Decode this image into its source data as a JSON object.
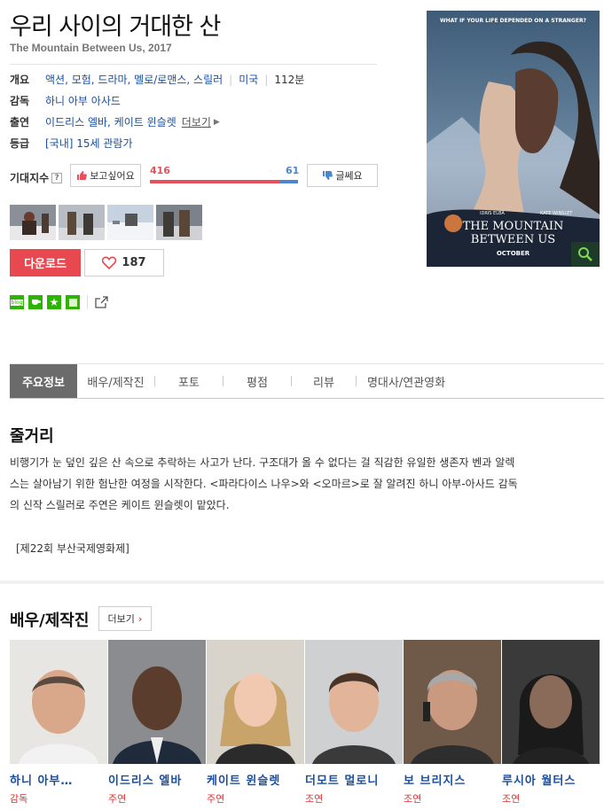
{
  "movie": {
    "title": "우리 사이의 거대한 산",
    "subtitle": "The Mountain Between Us, 2017"
  },
  "info": {
    "overview_label": "개요",
    "genres": "액션, 모험, 드라마, 멜로/로맨스, 스릴러",
    "country": "미국",
    "runtime": "112분",
    "director_label": "감독",
    "director": "하니 아부 아사드",
    "cast_label": "출연",
    "cast": "이드리스 엘바, 케이트 윈슬렛",
    "more_label": "더보기",
    "rating_label": "등급",
    "rating": "[국내] 15세 관람가"
  },
  "expect": {
    "label": "기대지수",
    "help": "?",
    "want_label": "보고싶어요",
    "want_count": "416",
    "meh_label": "글쎄요",
    "meh_count": "61",
    "colors": {
      "want": "#e8505b",
      "meh": "#4a86d4"
    }
  },
  "actions": {
    "download_label": "다운로드",
    "like_count": "187",
    "accent": "#e8484f"
  },
  "share": {
    "icons": [
      "blog-icon",
      "cafe-icon",
      "star-icon",
      "square-icon",
      "share-icon"
    ],
    "blog_text": "blog"
  },
  "poster": {
    "tagline": "WHAT IF YOUR LIFE DEPENDED ON A STRANGER?",
    "actor1": "IDRIS ELBA",
    "actor2": "KATE WINSLET",
    "title_line1": "THE MOUNTAIN",
    "title_line2": "BETWEEN US",
    "release": "OCTOBER"
  },
  "tabs": [
    "주요정보",
    "배우/제작진",
    "포토",
    "평점",
    "리뷰",
    "명대사/연관영화"
  ],
  "synopsis": {
    "heading": "줄거리",
    "line1": "비행기가 눈 덮인 깊은 산 속으로 추락하는 사고가 난다. 구조대가 올 수 없다는 걸 직감한 유일한 생존자 벤과 알렉",
    "line2": "스는 살아남기 위한 험난한 여정을 시작한다. <파라다이스 나우>와 <오마르>로 잘 알려진 하니 아부-아사드 감독",
    "line3": "의 신작 스릴러로 주연은 케이트 윈슬렛이 맡았다.",
    "festival": "[제22회 부산국제영화제]"
  },
  "cast_section": {
    "heading": "배우/제작진",
    "more_label": "더보기",
    "people": [
      {
        "name": "하니 아부…",
        "role": "감독"
      },
      {
        "name": "이드리스 엘바",
        "role": "주연"
      },
      {
        "name": "케이트 윈슬렛",
        "role": "주연"
      },
      {
        "name": "더모트 멀로니",
        "role": "조연"
      },
      {
        "name": "보 브리지스",
        "role": "조연"
      },
      {
        "name": "루시아 월터스",
        "role": "조연"
      }
    ]
  }
}
